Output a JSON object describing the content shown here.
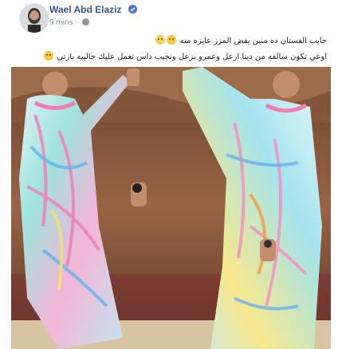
{
  "author": {
    "name": "Wael Abd Elaziz",
    "verified_icon": "verified-badge-icon"
  },
  "meta": {
    "time": "9 mins",
    "separator": "·",
    "audience_icon": "globe-icon"
  },
  "caption": {
    "line1": "جايب الفستان ده منين يفض المزز عايزه منه",
    "line2": "اوعي تكون سالفه من دينا ارعل وعمرو يزعل ونجيب داس تعمل عليك جاليبه بارتي",
    "emojis": [
      "thinking-face-icon",
      "crying-face-icon",
      "grinning-face-icon"
    ]
  },
  "media": {
    "description_icon": "video-thumbnail",
    "accent_colors": [
      "#7fd6d0",
      "#f48dc0",
      "#f5e36a",
      "#6ab0ef",
      "#f59b3f"
    ]
  }
}
